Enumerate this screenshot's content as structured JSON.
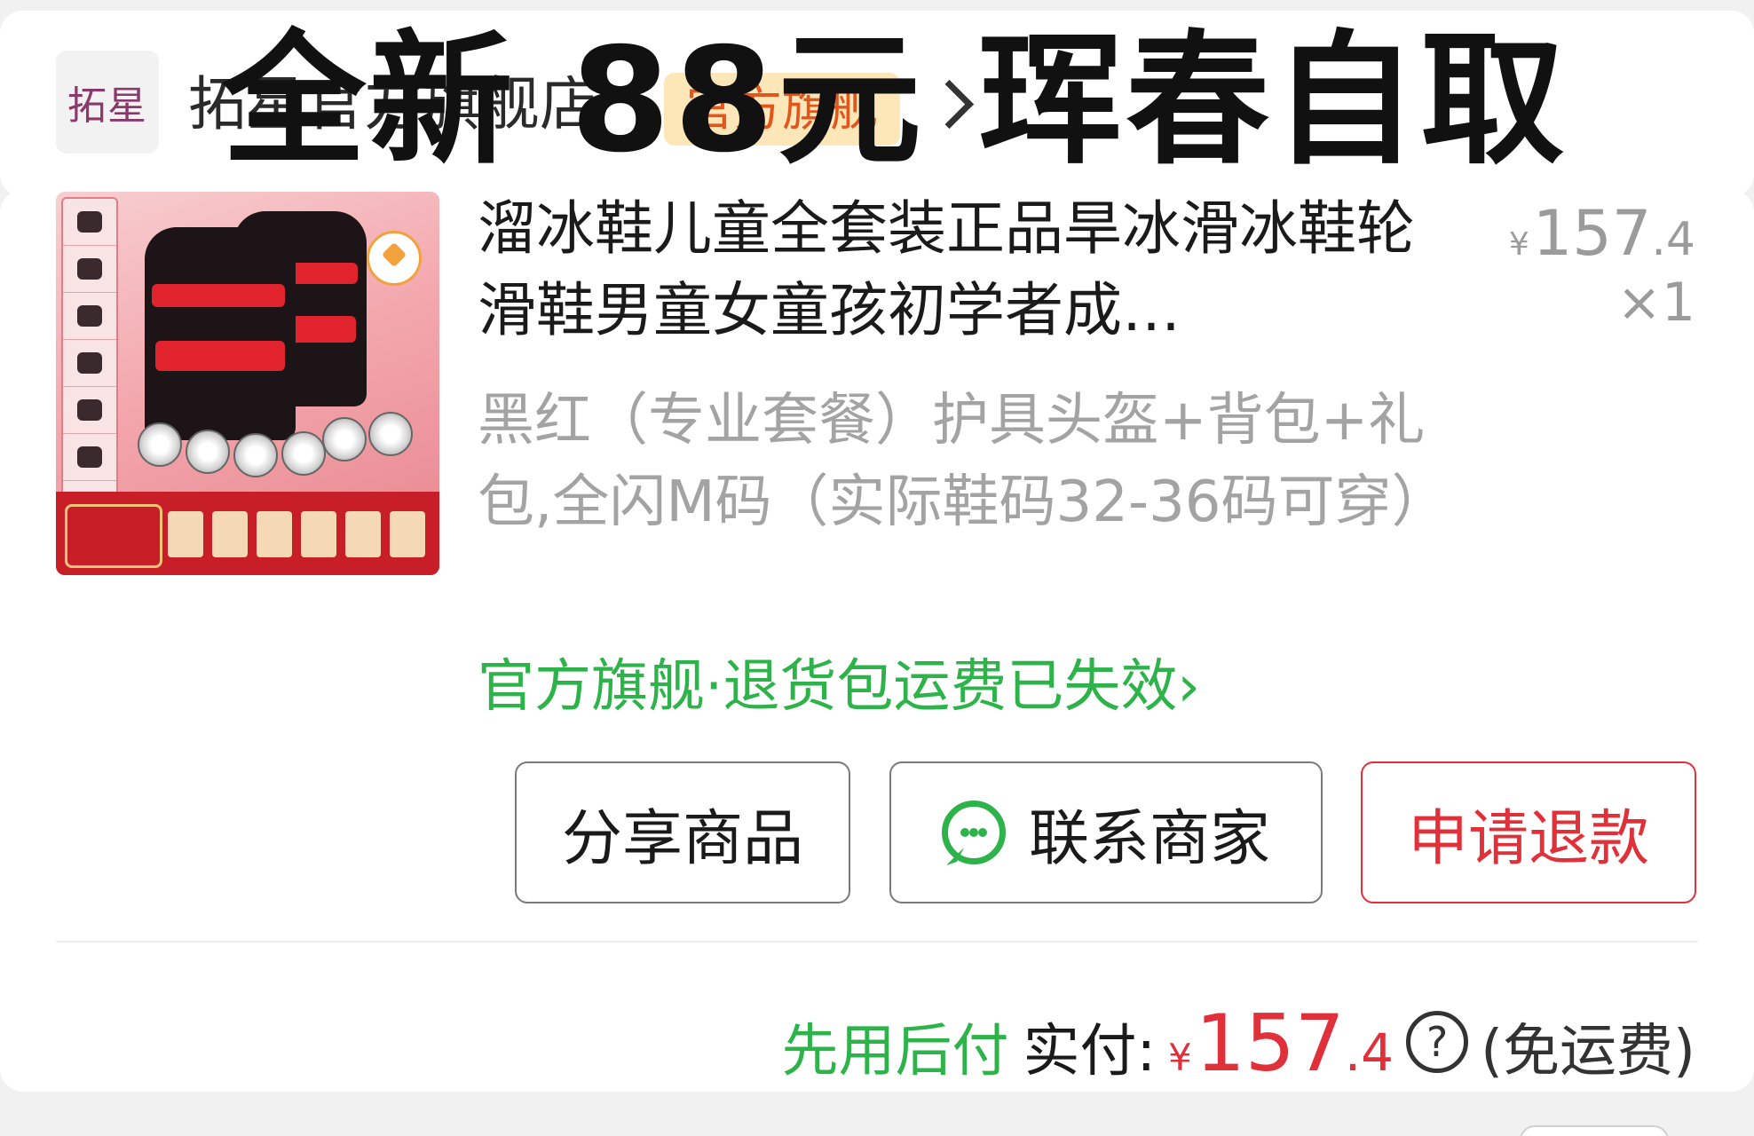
{
  "overlay": {
    "title": "全新 88元 珲春自取"
  },
  "store": {
    "logo_text": "拓星",
    "name": "拓星官方旗舰店",
    "badge": "官方旗舰"
  },
  "product": {
    "title": "溜冰鞋儿童全套装正品旱冰滑冰鞋轮滑鞋男童女童孩初学者成…",
    "price_currency": "¥",
    "price_int": "157",
    "price_dec": ".4",
    "quantity": "×1",
    "variant": "黑红（专业套餐）护具头盔+背包+礼包,全闪M码（实际鞋码32-36码可穿）",
    "return_policy": "官方旗舰·退货包运费已失效",
    "return_policy_arrow": "›"
  },
  "actions": {
    "share": "分享商品",
    "contact": "联系商家",
    "refund": "申请退款"
  },
  "payment": {
    "pay_later": "先用后付",
    "label": "实付:",
    "currency": "¥",
    "int": "157",
    "dec": ".4",
    "help": "?",
    "shipping": "(免运费)"
  },
  "colors": {
    "green": "#2db34a",
    "red": "#e0303a",
    "gray_text": "#a3a3a3",
    "badge_bg": "#fde6b8",
    "badge_text": "#e2551c"
  },
  "icons": {
    "chat": "chat-bubble-icon",
    "help": "question-circle-icon",
    "store_arrow": "chevron-right-icon"
  }
}
